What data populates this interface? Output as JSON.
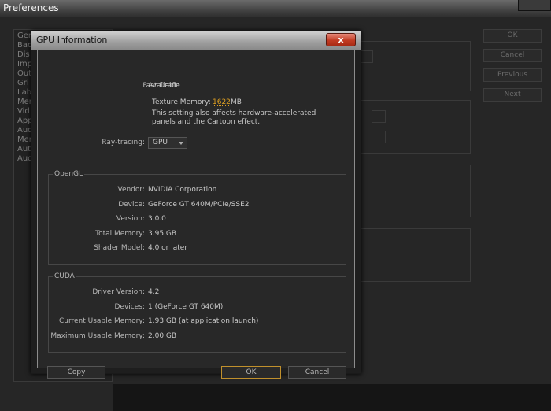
{
  "background_window": {
    "title": "Preferences",
    "list_items": [
      "Gen",
      "Bac",
      "Dis",
      "Imp",
      "Out",
      "Gri",
      "Lab",
      "Mer",
      "Vid",
      "App",
      "Aud",
      "Mer",
      "Aut",
      "Aud"
    ],
    "buttons": {
      "ok": "OK",
      "cancel": "Cancel",
      "previous": "Previous",
      "next": "Next"
    }
  },
  "dialog": {
    "title": "GPU Information",
    "close_glyph": "x",
    "fast_draft_label": "Fast Draft:",
    "fast_draft_value": "Available",
    "texture_memory_label": "Texture Memory:",
    "texture_memory_value": "1622",
    "texture_memory_unit": "MB",
    "note_line1": "This setting also affects hardware-accelerated",
    "note_line2": "panels and the Cartoon effect.",
    "ray_tracing_label": "Ray-tracing:",
    "ray_tracing_value": "GPU",
    "opengl": {
      "title": "OpenGL",
      "rows": [
        {
          "label": "Vendor:",
          "value": "NVIDIA Corporation"
        },
        {
          "label": "Device:",
          "value": "GeForce GT 640M/PCIe/SSE2"
        },
        {
          "label": "Version:",
          "value": "3.0.0"
        },
        {
          "label": "Total Memory:",
          "value": "3.95 GB"
        },
        {
          "label": "Shader Model:",
          "value": "4.0 or later"
        }
      ]
    },
    "cuda": {
      "title": "CUDA",
      "rows": [
        {
          "label": "Driver Version:",
          "value": "4.2"
        },
        {
          "label": "Devices:",
          "value": "1 (GeForce GT 640M)"
        },
        {
          "label": "Current Usable Memory:",
          "value": "1.93 GB (at application launch)"
        },
        {
          "label": "Maximum Usable Memory:",
          "value": "2.00 GB"
        }
      ]
    },
    "buttons": {
      "copy": "Copy",
      "ok": "OK",
      "cancel": "Cancel"
    },
    "accent_color": "#e0a020"
  }
}
